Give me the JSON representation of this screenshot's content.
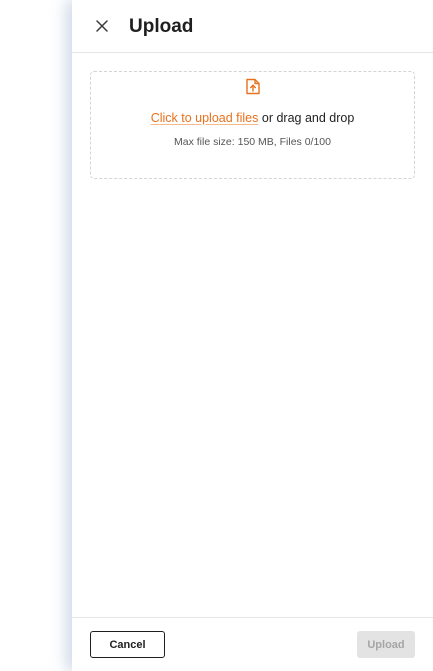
{
  "drawer": {
    "title": "Upload",
    "close_icon": "close-icon"
  },
  "dropzone": {
    "icon": "file-upload-icon",
    "link_text": "Click to upload files",
    "rest_text": " or drag and drop",
    "hint": "Max file size: 150 MB, Files 0/100"
  },
  "footer": {
    "cancel_label": "Cancel",
    "upload_label": "Upload"
  },
  "colors": {
    "accent": "#e8711d",
    "text": "#1f1f1f",
    "muted": "#555555",
    "disabled_bg": "#e3e3e3",
    "disabled_text": "#a5a5a5"
  }
}
